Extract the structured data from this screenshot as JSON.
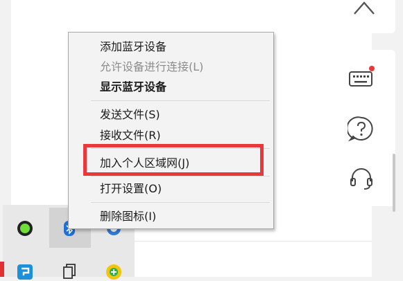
{
  "context_menu": {
    "items": [
      {
        "label": "添加蓝牙设备",
        "state": "normal"
      },
      {
        "label": "允许设备进行连接(L)",
        "state": "disabled"
      },
      {
        "label": "显示蓝牙设备",
        "state": "default"
      },
      {
        "label": "发送文件(S)",
        "state": "normal"
      },
      {
        "label": "接收文件(R)",
        "state": "normal"
      },
      {
        "label": "加入个人区域网(J)",
        "state": "highlighted"
      },
      {
        "label": "打开设置(O)",
        "state": "normal"
      },
      {
        "label": "删除图标(I)",
        "state": "normal"
      }
    ]
  },
  "side_panel": {
    "icons": [
      "chevron-up-icon",
      "keyboard-icon",
      "help-icon",
      "headset-icon"
    ],
    "notification_dot_color": "#e8383b"
  },
  "tray": {
    "icons": [
      "green-status-icon",
      "bluetooth-icon",
      "network-icon",
      "app-icon",
      "copy-icon",
      "chat-icon"
    ]
  },
  "colors": {
    "highlight": "#e8383b",
    "bluetooth": "#1e6fd9"
  }
}
